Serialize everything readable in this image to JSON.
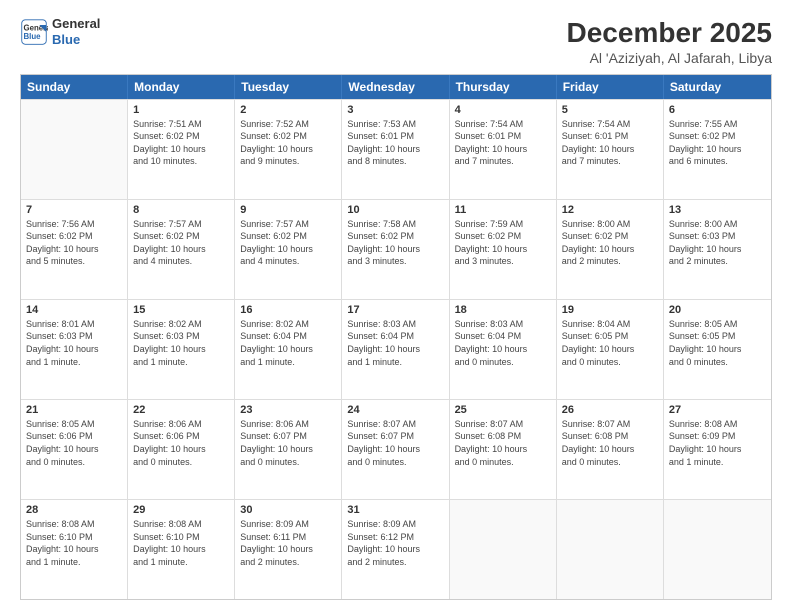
{
  "header": {
    "logo_line1": "General",
    "logo_line2": "Blue",
    "main_title": "December 2025",
    "subtitle": "Al 'Aziziyah, Al Jafarah, Libya"
  },
  "calendar": {
    "days_of_week": [
      "Sunday",
      "Monday",
      "Tuesday",
      "Wednesday",
      "Thursday",
      "Friday",
      "Saturday"
    ],
    "rows": [
      [
        {
          "day": "",
          "info": ""
        },
        {
          "day": "1",
          "info": "Sunrise: 7:51 AM\nSunset: 6:02 PM\nDaylight: 10 hours\nand 10 minutes."
        },
        {
          "day": "2",
          "info": "Sunrise: 7:52 AM\nSunset: 6:02 PM\nDaylight: 10 hours\nand 9 minutes."
        },
        {
          "day": "3",
          "info": "Sunrise: 7:53 AM\nSunset: 6:01 PM\nDaylight: 10 hours\nand 8 minutes."
        },
        {
          "day": "4",
          "info": "Sunrise: 7:54 AM\nSunset: 6:01 PM\nDaylight: 10 hours\nand 7 minutes."
        },
        {
          "day": "5",
          "info": "Sunrise: 7:54 AM\nSunset: 6:01 PM\nDaylight: 10 hours\nand 7 minutes."
        },
        {
          "day": "6",
          "info": "Sunrise: 7:55 AM\nSunset: 6:02 PM\nDaylight: 10 hours\nand 6 minutes."
        }
      ],
      [
        {
          "day": "7",
          "info": "Sunrise: 7:56 AM\nSunset: 6:02 PM\nDaylight: 10 hours\nand 5 minutes."
        },
        {
          "day": "8",
          "info": "Sunrise: 7:57 AM\nSunset: 6:02 PM\nDaylight: 10 hours\nand 4 minutes."
        },
        {
          "day": "9",
          "info": "Sunrise: 7:57 AM\nSunset: 6:02 PM\nDaylight: 10 hours\nand 4 minutes."
        },
        {
          "day": "10",
          "info": "Sunrise: 7:58 AM\nSunset: 6:02 PM\nDaylight: 10 hours\nand 3 minutes."
        },
        {
          "day": "11",
          "info": "Sunrise: 7:59 AM\nSunset: 6:02 PM\nDaylight: 10 hours\nand 3 minutes."
        },
        {
          "day": "12",
          "info": "Sunrise: 8:00 AM\nSunset: 6:02 PM\nDaylight: 10 hours\nand 2 minutes."
        },
        {
          "day": "13",
          "info": "Sunrise: 8:00 AM\nSunset: 6:03 PM\nDaylight: 10 hours\nand 2 minutes."
        }
      ],
      [
        {
          "day": "14",
          "info": "Sunrise: 8:01 AM\nSunset: 6:03 PM\nDaylight: 10 hours\nand 1 minute."
        },
        {
          "day": "15",
          "info": "Sunrise: 8:02 AM\nSunset: 6:03 PM\nDaylight: 10 hours\nand 1 minute."
        },
        {
          "day": "16",
          "info": "Sunrise: 8:02 AM\nSunset: 6:04 PM\nDaylight: 10 hours\nand 1 minute."
        },
        {
          "day": "17",
          "info": "Sunrise: 8:03 AM\nSunset: 6:04 PM\nDaylight: 10 hours\nand 1 minute."
        },
        {
          "day": "18",
          "info": "Sunrise: 8:03 AM\nSunset: 6:04 PM\nDaylight: 10 hours\nand 0 minutes."
        },
        {
          "day": "19",
          "info": "Sunrise: 8:04 AM\nSunset: 6:05 PM\nDaylight: 10 hours\nand 0 minutes."
        },
        {
          "day": "20",
          "info": "Sunrise: 8:05 AM\nSunset: 6:05 PM\nDaylight: 10 hours\nand 0 minutes."
        }
      ],
      [
        {
          "day": "21",
          "info": "Sunrise: 8:05 AM\nSunset: 6:06 PM\nDaylight: 10 hours\nand 0 minutes."
        },
        {
          "day": "22",
          "info": "Sunrise: 8:06 AM\nSunset: 6:06 PM\nDaylight: 10 hours\nand 0 minutes."
        },
        {
          "day": "23",
          "info": "Sunrise: 8:06 AM\nSunset: 6:07 PM\nDaylight: 10 hours\nand 0 minutes."
        },
        {
          "day": "24",
          "info": "Sunrise: 8:07 AM\nSunset: 6:07 PM\nDaylight: 10 hours\nand 0 minutes."
        },
        {
          "day": "25",
          "info": "Sunrise: 8:07 AM\nSunset: 6:08 PM\nDaylight: 10 hours\nand 0 minutes."
        },
        {
          "day": "26",
          "info": "Sunrise: 8:07 AM\nSunset: 6:08 PM\nDaylight: 10 hours\nand 0 minutes."
        },
        {
          "day": "27",
          "info": "Sunrise: 8:08 AM\nSunset: 6:09 PM\nDaylight: 10 hours\nand 1 minute."
        }
      ],
      [
        {
          "day": "28",
          "info": "Sunrise: 8:08 AM\nSunset: 6:10 PM\nDaylight: 10 hours\nand 1 minute."
        },
        {
          "day": "29",
          "info": "Sunrise: 8:08 AM\nSunset: 6:10 PM\nDaylight: 10 hours\nand 1 minute."
        },
        {
          "day": "30",
          "info": "Sunrise: 8:09 AM\nSunset: 6:11 PM\nDaylight: 10 hours\nand 2 minutes."
        },
        {
          "day": "31",
          "info": "Sunrise: 8:09 AM\nSunset: 6:12 PM\nDaylight: 10 hours\nand 2 minutes."
        },
        {
          "day": "",
          "info": ""
        },
        {
          "day": "",
          "info": ""
        },
        {
          "day": "",
          "info": ""
        }
      ]
    ]
  }
}
